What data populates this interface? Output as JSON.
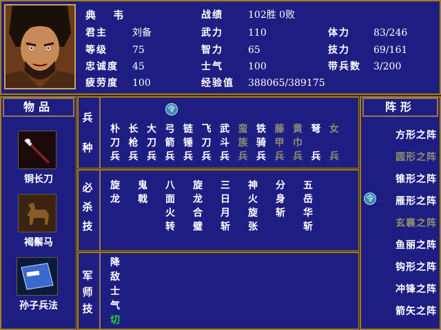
{
  "general": {
    "name": "典 韦",
    "lord_label": "君主",
    "lord": "刘备",
    "level_label": "等级",
    "level": "75",
    "loyalty_label": "忠诚度",
    "loyalty": "45",
    "fatigue_label": "疲劳度",
    "fatigue": "100",
    "record_label": "战绩",
    "record": "102胜 0败",
    "force_label": "武力",
    "force": "110",
    "intel_label": "智力",
    "intel": "65",
    "morale_label": "士气",
    "morale": "100",
    "exp_label": "经验值",
    "exp": "388065/389175",
    "hp_label": "体力",
    "hp": "83/246",
    "skill_label": "技力",
    "skill": "69/161",
    "troops_label": "带兵数",
    "troops": "3/200"
  },
  "items": {
    "title": "物品",
    "list": [
      {
        "name": "铜长刀",
        "icon": "sword-icon"
      },
      {
        "name": "褐鬃马",
        "icon": "horse-icon"
      },
      {
        "name": "孙子兵法",
        "icon": "book-icon"
      }
    ]
  },
  "troop_types": {
    "label": [
      "兵",
      "种"
    ],
    "selected_marker": "令",
    "list": [
      {
        "c": [
          "朴",
          "刀",
          "兵"
        ],
        "dim": false
      },
      {
        "c": [
          "长",
          "枪",
          "兵"
        ],
        "dim": false
      },
      {
        "c": [
          "大",
          "刀",
          "兵"
        ],
        "dim": false
      },
      {
        "c": [
          "弓",
          "箭",
          "兵"
        ],
        "dim": false
      },
      {
        "c": [
          "链",
          "锤",
          "兵"
        ],
        "dim": false
      },
      {
        "c": [
          "飞",
          "刀",
          "兵"
        ],
        "dim": false
      },
      {
        "c": [
          "武",
          "斗",
          "兵"
        ],
        "dim": false
      },
      {
        "c": [
          "蛮",
          "族",
          "兵"
        ],
        "dim": true
      },
      {
        "c": [
          "铁",
          "骑",
          "兵"
        ],
        "dim": false
      },
      {
        "c": [
          "藤",
          "甲",
          "兵"
        ],
        "dim": true
      },
      {
        "c": [
          "黄",
          "巾",
          "兵"
        ],
        "dim": true
      },
      {
        "c": [
          "弩",
          "",
          "兵"
        ],
        "dim": false
      },
      {
        "c": [
          "女",
          "",
          "兵"
        ],
        "dim": true
      }
    ]
  },
  "special_skills": {
    "label": [
      "必",
      "杀",
      "技"
    ],
    "list": [
      [
        "旋",
        "龙"
      ],
      [
        "鬼",
        "戟"
      ],
      [
        "八",
        "面",
        "火",
        "转"
      ],
      [
        "旋",
        "龙",
        "合",
        "璧"
      ],
      [
        "三",
        "日",
        "月",
        "斩"
      ],
      [
        "神",
        "火",
        "旋",
        "张"
      ],
      [
        "分",
        "身",
        "斩"
      ],
      [
        "五",
        "岳",
        "华",
        "斩"
      ]
    ]
  },
  "strategy": {
    "label": [
      "军",
      "师",
      "技"
    ],
    "list": [
      {
        "c": [
          "降",
          "敌",
          "士",
          "气",
          "切"
        ]
      }
    ]
  },
  "formations": {
    "title": "阵形",
    "selected_marker": "令",
    "list": [
      {
        "name": "方形之阵",
        "dim": false
      },
      {
        "name": "圆形之阵",
        "dim": true
      },
      {
        "name": "锥形之阵",
        "dim": false
      },
      {
        "name": "雁形之阵",
        "dim": false
      },
      {
        "name": "玄襄之阵",
        "dim": true
      },
      {
        "name": "鱼丽之阵",
        "dim": false
      },
      {
        "name": "钩形之阵",
        "dim": false
      },
      {
        "name": "冲锋之阵",
        "dim": false
      },
      {
        "name": "箭矢之阵",
        "dim": false
      }
    ]
  },
  "colors": {
    "panel": "#1e1e82",
    "border": "#9a7a4a",
    "dim_text": "#8e8e70",
    "highlight": "#22dd22"
  }
}
